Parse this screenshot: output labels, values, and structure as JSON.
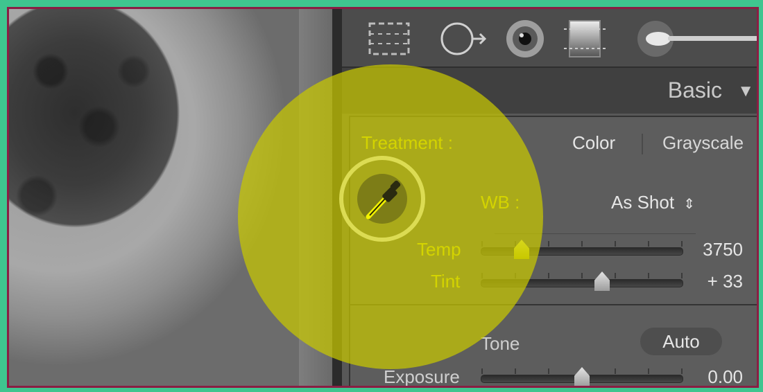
{
  "toolstrip": {
    "tools": [
      {
        "icon": "crop-overlay-icon"
      },
      {
        "icon": "spot-removal-icon"
      },
      {
        "icon": "red-eye-icon"
      },
      {
        "icon": "graduated-filter-icon"
      },
      {
        "icon": "adjustment-brush-icon"
      }
    ]
  },
  "panel": {
    "title": "Basic",
    "collapse_icon": "triangle-down-icon"
  },
  "treatment": {
    "label": "Treatment :",
    "options": [
      "Color",
      "Grayscale"
    ],
    "selected": "Color"
  },
  "wb": {
    "label": "WB :",
    "value": "As Shot",
    "picker_icon": "eyedropper-icon",
    "sliders": [
      {
        "label": "Temp",
        "value": "3750",
        "position": 0.2
      },
      {
        "label": "Tint",
        "value": "+ 33",
        "position": 0.6
      }
    ]
  },
  "tone": {
    "label": "Tone",
    "auto_label": "Auto",
    "sliders": [
      {
        "label": "Exposure",
        "value": "0.00",
        "position": 0.5
      }
    ]
  },
  "colors": {
    "highlight": "#f2f200",
    "frame_border": "#8a1e44",
    "background": "#3fc58f"
  }
}
